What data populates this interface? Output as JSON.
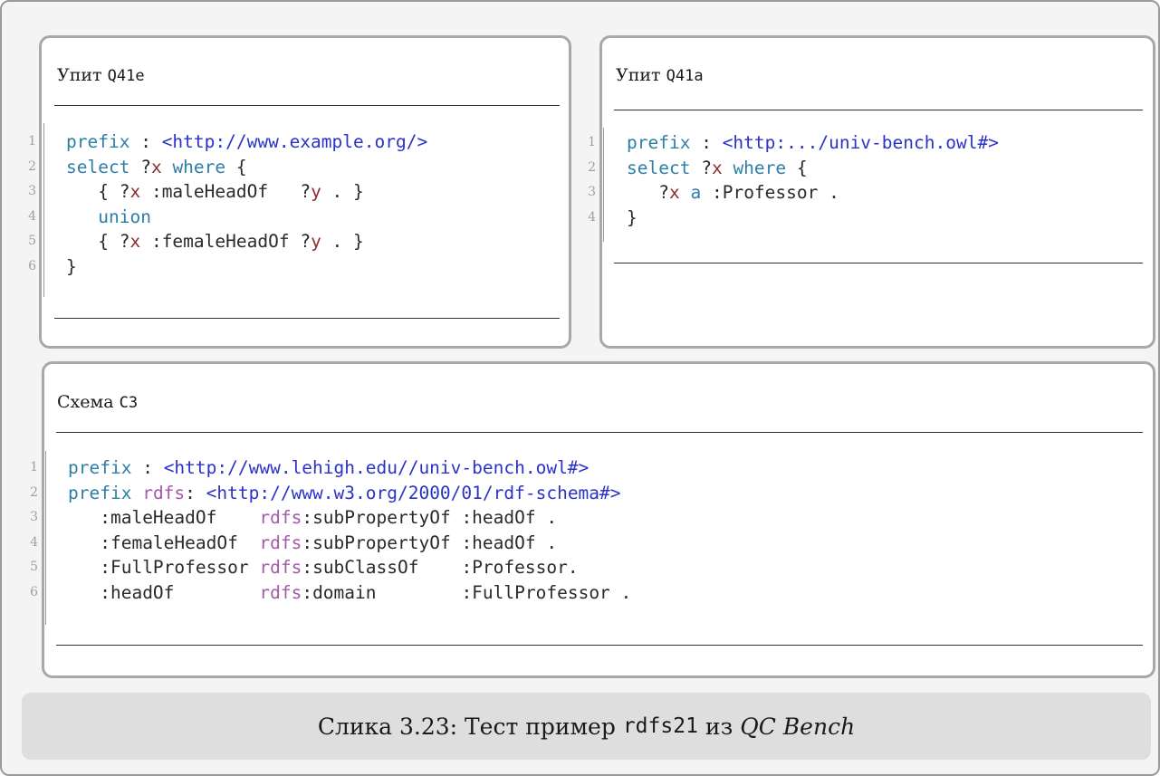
{
  "query_left": {
    "title_text": "Упит",
    "title_code": "Q41e",
    "line_numbers": [
      "1",
      "2",
      "3",
      "4",
      "5",
      "6"
    ]
  },
  "query_right": {
    "title_text": "Упит",
    "title_code": "Q41a",
    "line_numbers": [
      "1",
      "2",
      "3",
      "4"
    ]
  },
  "schema": {
    "title_text": "Схема",
    "title_code": "C3",
    "line_numbers": [
      "1",
      "2",
      "3",
      "4",
      "5",
      "6"
    ]
  },
  "code_tokens": {
    "prefix": "prefix",
    "select": "select",
    "where": "where",
    "union": "union",
    "a": "a",
    "rdfs": "rdfs",
    "var_x": "x",
    "var_y": "y",
    "uri_example": "<http://www.example.org/>",
    "uri_univ_short": "<http:.../univ-bench.owl#>",
    "uri_lehigh": "<http://www.lehigh.edu//univ-bench.owl#>",
    "uri_w3": "<http://www.w3.org/2000/01/rdf-schema#>",
    "maleHeadOf": ":maleHeadOf",
    "femaleHeadOf": ":femaleHeadOf",
    "fullProfessor": ":FullProfessor",
    "headOf": ":headOf",
    "professor": ":Professor",
    "subPropertyOf": "subPropertyOf",
    "subClassOf": "subClassOf",
    "domain": "domain"
  },
  "caption": {
    "prefix": "Слика 3.23: Тест пример",
    "code": "rdfs21",
    "middle": "из",
    "italic": "QC Bench"
  }
}
